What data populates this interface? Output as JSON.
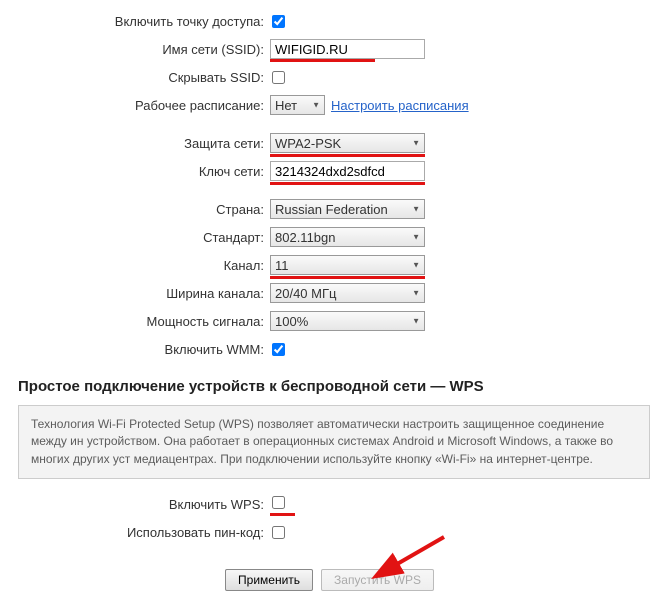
{
  "labels": {
    "enableAP": "Включить точку доступа:",
    "ssid": "Имя сети (SSID):",
    "hideSSID": "Скрывать SSID:",
    "schedule": "Рабочее расписание:",
    "security": "Защита сети:",
    "key": "Ключ сети:",
    "country": "Страна:",
    "standard": "Стандарт:",
    "channel": "Канал:",
    "channelWidth": "Ширина канала:",
    "signalPower": "Мощность сигнала:",
    "enableWMM": "Включить WMM:",
    "enableWPS": "Включить WPS:",
    "usePin": "Использовать пин-код:"
  },
  "values": {
    "ssid": "WIFIGID.RU",
    "schedule": "Нет",
    "security": "WPA2-PSK",
    "key": "3214324dxd2sdfcd",
    "country": "Russian Federation",
    "standard": "802.11bgn",
    "channel": "11",
    "channelWidth": "20/40 МГц",
    "signalPower": "100%"
  },
  "link": {
    "configureSchedule": "Настроить расписания"
  },
  "section": {
    "wpsHeading": "Простое подключение устройств к беспроводной сети — WPS",
    "wpsInfo": "Технология Wi-Fi Protected Setup (WPS) позволяет автоматически настроить защищенное соединение между ин устройством. Она работает в операционных системах Android и Microsoft Windows, а также во многих других уст медиацентрах. При подключении используйте кнопку «Wi-Fi» на интернет-центре."
  },
  "buttons": {
    "apply": "Применить",
    "startWPS": "Запустить WPS"
  },
  "checkboxes": {
    "enableAP": true,
    "hideSSID": false,
    "enableWMM": true,
    "enableWPS": false,
    "usePin": false
  }
}
